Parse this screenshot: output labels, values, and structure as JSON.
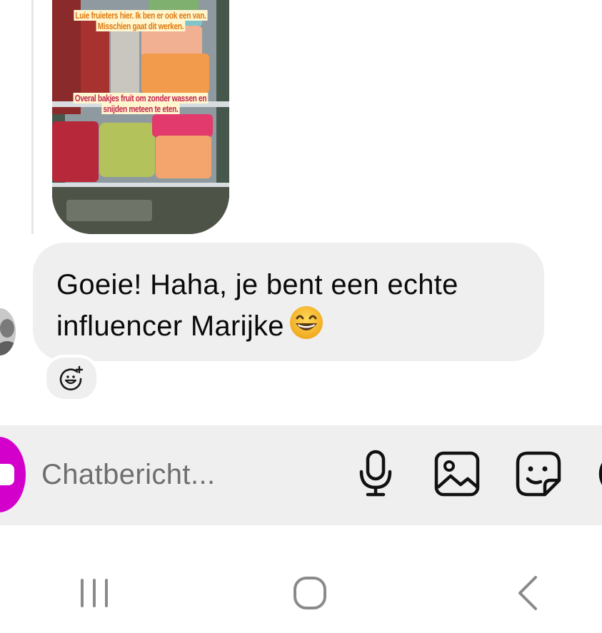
{
  "story_reply": {
    "caption_1": "Luie fruieters hier. Ik ben er ook een van. Misschien gaat dit werken.",
    "caption_2": "Overal bakjes fruit om zonder wassen en snijden meteen te eten."
  },
  "message": {
    "text": "Goeie! Haha, je bent een echte influencer Marijke",
    "emoji": "grinning-face-with-smiling-eyes"
  },
  "composer": {
    "placeholder": "Chatbericht..."
  },
  "icons": {
    "reaction": "add-reaction-icon",
    "camera": "camera-icon",
    "mic": "microphone-icon",
    "gallery": "gallery-icon",
    "sticker": "sticker-icon",
    "more": "more-icon",
    "recents": "recents-icon",
    "home": "home-icon",
    "back": "back-icon"
  },
  "colors": {
    "bubble": "#efefef",
    "composer": "#efefef",
    "camera_button": "#d300cc",
    "caption_1": "#e07a10",
    "caption_2": "#c2254d",
    "nav_icons": "#8a8a8a"
  }
}
